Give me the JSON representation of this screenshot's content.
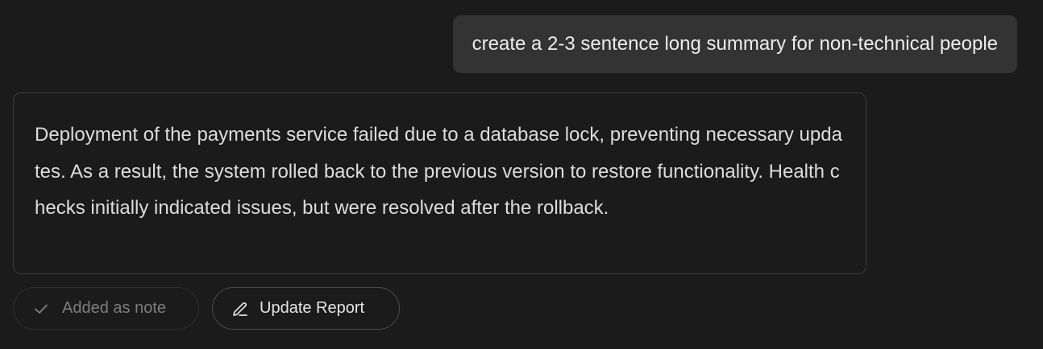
{
  "chat": {
    "user_message": "create a 2-3 sentence long summary for non-technical people",
    "assistant_response": "Deployment of the payments service failed due to a database lock, preventing necessary updates. As a result, the system rolled back to the previous version to restore functionality. Health checks initially indicated issues, but were resolved after the rollback."
  },
  "actions": {
    "added_note": {
      "label": "Added as note",
      "icon": "check-icon",
      "state": "disabled"
    },
    "update_report": {
      "label": "Update Report",
      "icon": "pencil-icon"
    }
  }
}
